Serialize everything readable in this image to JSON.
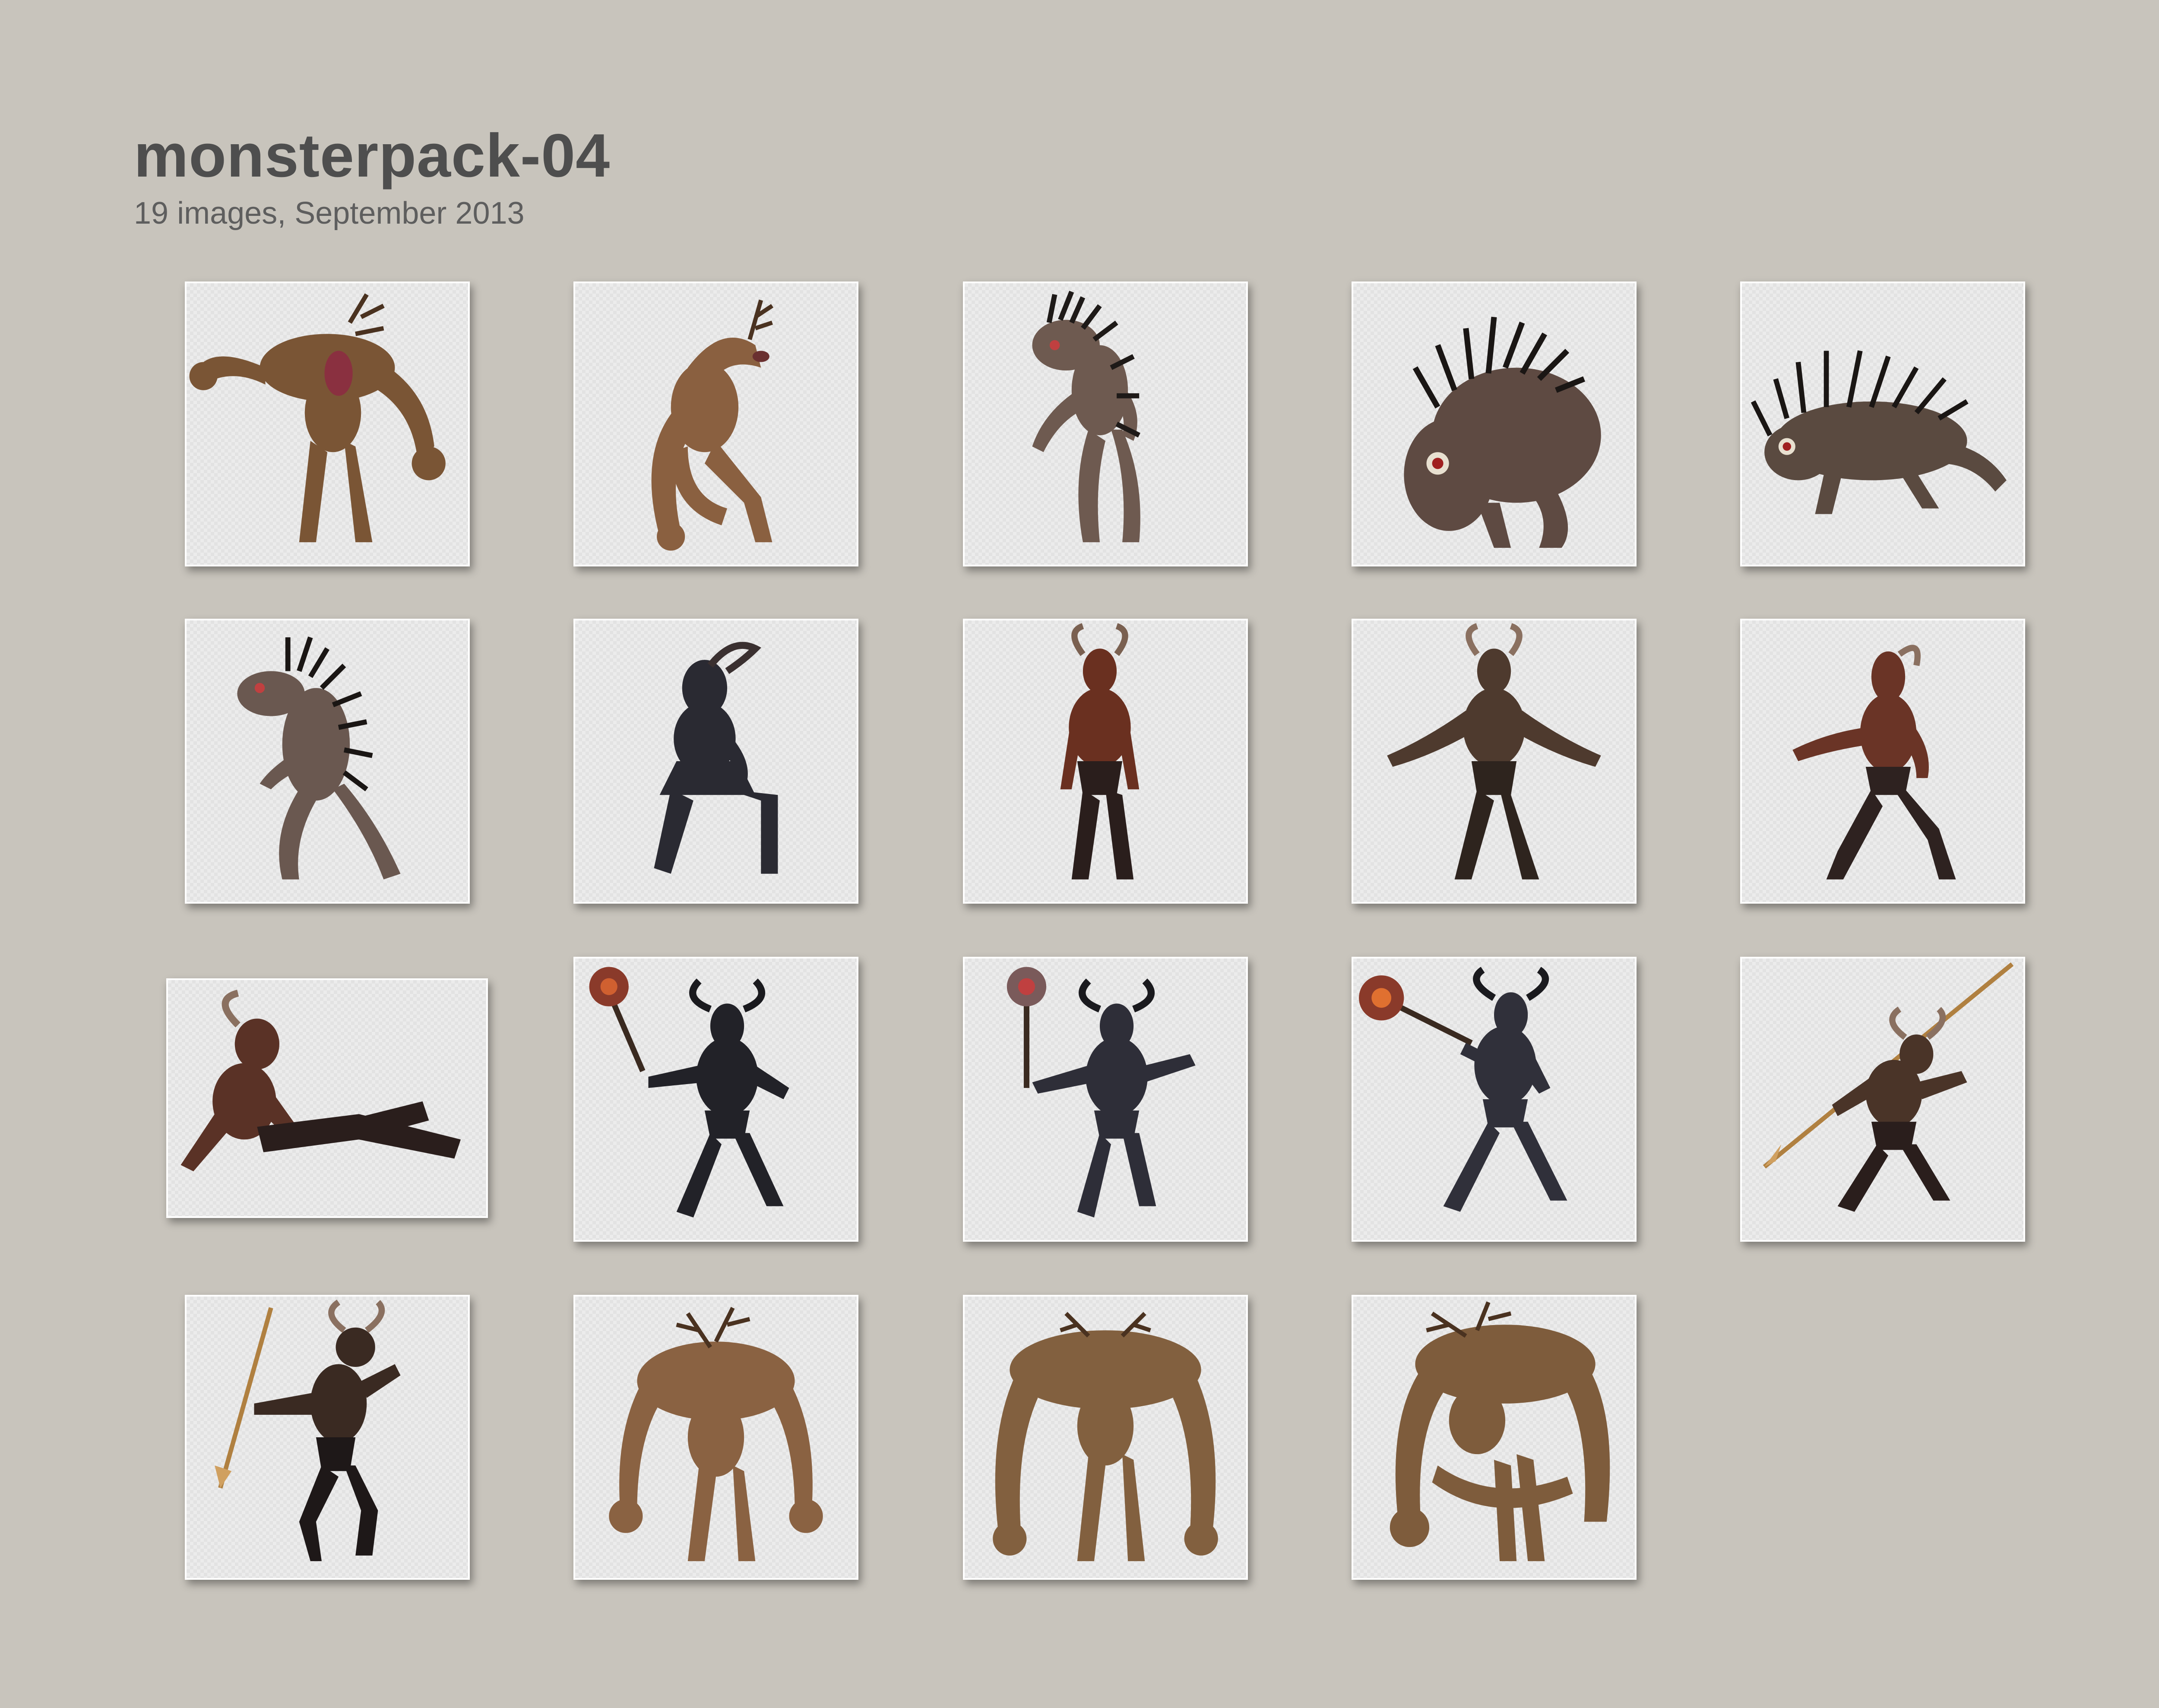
{
  "header": {
    "title": "monsterpack-04",
    "subtitle": "19 images, September 2013"
  },
  "gallery": {
    "thumbnails": [
      {
        "icon": "deer-beast-hunched-icon",
        "fur": "#7a5535"
      },
      {
        "icon": "deer-beast-leaping-icon",
        "fur": "#8a6040"
      },
      {
        "icon": "spiked-creature-standing-icon",
        "fur": "#6e5a50"
      },
      {
        "icon": "spiked-creature-crouching-icon",
        "fur": "#5e4a42"
      },
      {
        "icon": "spiked-creature-crawling-icon",
        "fur": "#5a4a40"
      },
      {
        "icon": "spiked-creature-walking-icon",
        "fur": "#6a5850"
      },
      {
        "icon": "black-goat-demon-sitting-icon",
        "fur": "#2a2a32"
      },
      {
        "icon": "red-goat-demon-standing-icon",
        "fur": "#6a3020"
      },
      {
        "icon": "brown-goat-demon-arms-open-icon",
        "fur": "#4e3a2e"
      },
      {
        "icon": "red-goat-demon-walking-icon",
        "fur": "#6a3426"
      },
      {
        "icon": "goat-demon-reclining-icon",
        "fur": "#5a3226"
      },
      {
        "icon": "black-goat-demon-mace-icon",
        "fur": "#222228"
      },
      {
        "icon": "black-goat-demon-mace-raised-icon",
        "fur": "#2e2e38"
      },
      {
        "icon": "black-goat-demon-mace-swing-icon",
        "fur": "#30303a"
      },
      {
        "icon": "goat-demon-spear-throw-icon",
        "fur": "#4a3428"
      },
      {
        "icon": "goat-demon-spear-leap-icon",
        "fur": "#3a2a22"
      },
      {
        "icon": "deer-beast-standing-icon",
        "fur": "#8a6242"
      },
      {
        "icon": "deer-beast-front-icon",
        "fur": "#82603f"
      },
      {
        "icon": "deer-beast-crouch-icon",
        "fur": "#7e5c3c"
      }
    ]
  }
}
